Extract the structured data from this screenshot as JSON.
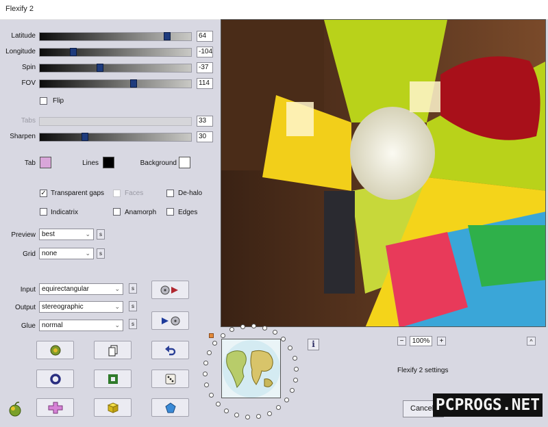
{
  "window": {
    "title": "Flexify 2"
  },
  "sliders": [
    {
      "id": "latitude",
      "label": "Latitude",
      "value": "64",
      "fraction": 0.84,
      "enabled": true
    },
    {
      "id": "longitude",
      "label": "Longitude",
      "value": "-104",
      "fraction": 0.22,
      "enabled": true
    },
    {
      "id": "spin",
      "label": "Spin",
      "value": "-37",
      "fraction": 0.4,
      "enabled": true
    },
    {
      "id": "fov",
      "label": "FOV",
      "value": "114",
      "fraction": 0.62,
      "enabled": true
    },
    {
      "id": "tabs",
      "label": "Tabs",
      "value": "33",
      "fraction": 0.33,
      "enabled": false
    },
    {
      "id": "sharpen",
      "label": "Sharpen",
      "value": "30",
      "fraction": 0.3,
      "enabled": true
    }
  ],
  "flip": {
    "label": "Flip",
    "checked": false
  },
  "colors": {
    "tab": {
      "label": "Tab",
      "color": "#d9a6d9"
    },
    "lines": {
      "label": "Lines",
      "color": "#000000"
    },
    "background": {
      "label": "Background",
      "color": "#ffffff"
    }
  },
  "options": {
    "transparent_gaps": {
      "label": "Transparent gaps",
      "checked": true
    },
    "faces": {
      "label": "Faces",
      "checked": false,
      "enabled": false
    },
    "de_halo": {
      "label": "De-halo",
      "checked": false
    },
    "indicatrix": {
      "label": "Indicatrix",
      "checked": false
    },
    "anamorph": {
      "label": "Anamorph",
      "checked": false
    },
    "edges": {
      "label": "Edges",
      "checked": false
    }
  },
  "preview": {
    "label": "Preview",
    "value": "best"
  },
  "grid": {
    "label": "Grid",
    "value": "none"
  },
  "input": {
    "label": "Input",
    "value": "equirectangular"
  },
  "output": {
    "label": "Output",
    "value": "stereographic"
  },
  "glue": {
    "label": "Glue",
    "value": "normal"
  },
  "s_label": "s",
  "zoom": {
    "value": "100%",
    "minus": "−",
    "plus": "+"
  },
  "info_label": "i",
  "status": "Flexify 2 settings",
  "cancel_label": "Cancel",
  "watermark": "PCPROGS.NET",
  "check_mark": "✓",
  "dropdown_arrow": "⌄",
  "collapse_arrow": "^"
}
